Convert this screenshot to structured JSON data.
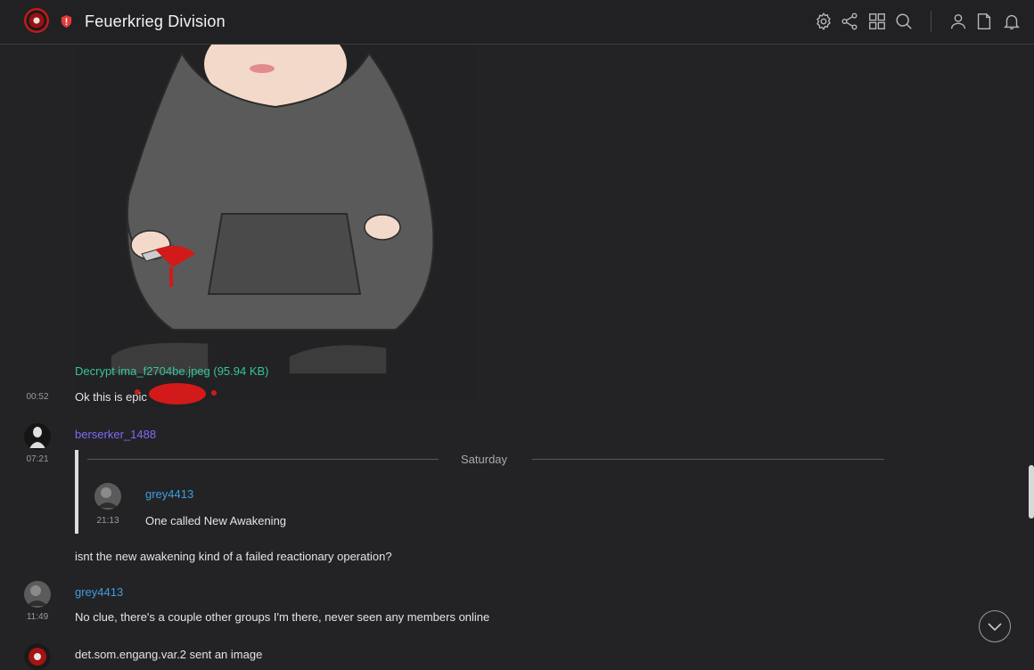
{
  "room": {
    "title": "Feuerkrieg Division"
  },
  "toolbar": {
    "icons": [
      "settings-icon",
      "share-icon",
      "grid-icon",
      "search-icon",
      "user-icon",
      "file-icon",
      "bell-icon"
    ]
  },
  "timeline": {
    "attachment": {
      "link_text": "Decrypt ima_f2704be.jpeg (95.94 KB)"
    },
    "messages": [
      {
        "time": "00:52",
        "text": "Ok this is epic"
      },
      {
        "sender": "berserker_1488",
        "time": "07:21"
      },
      {
        "reply": {
          "sender": "grey4413",
          "time": "21:13",
          "text": "One called New Awakening"
        }
      },
      {
        "text": "isnt the new awakening kind of a failed reactionary operation?"
      },
      {
        "sender": "grey4413",
        "time": "11:49",
        "text": "No clue, there's a couple other groups I'm there, never seen any members online"
      },
      {
        "text": "det.som.engang.var.2 sent an image"
      }
    ],
    "day_separator": "Saturday"
  },
  "colors": {
    "background": "#232325",
    "link_green": "#36c49a",
    "sender_purple": "#7b6cf6",
    "sender_blue": "#3f9de0"
  }
}
